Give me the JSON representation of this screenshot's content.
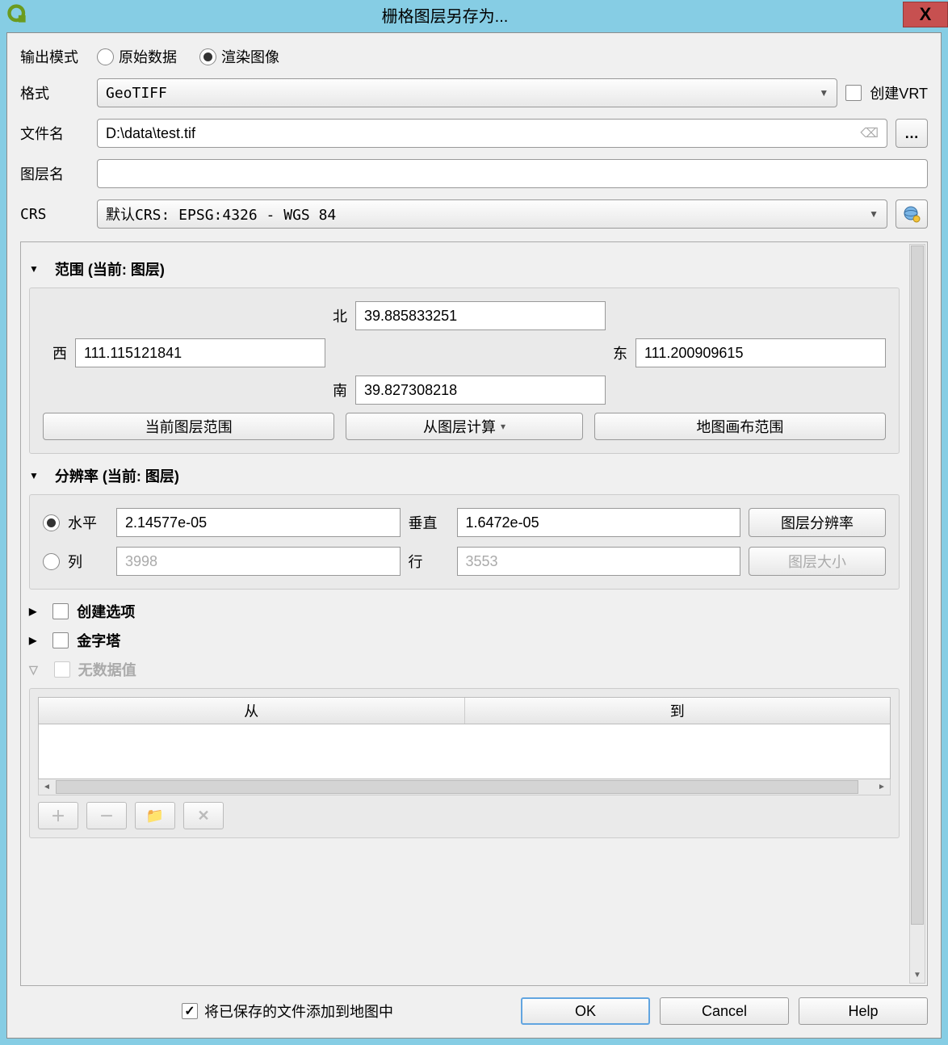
{
  "title": "栅格图层另存为...",
  "output_mode": {
    "label": "输出模式",
    "raw": "原始数据",
    "rendered": "渲染图像",
    "selected": "rendered"
  },
  "format": {
    "label": "格式",
    "value": "GeoTIFF"
  },
  "create_vrt": {
    "label": "创建VRT",
    "checked": false
  },
  "filename": {
    "label": "文件名",
    "value": "D:\\data\\test.tif"
  },
  "layername": {
    "label": "图层名",
    "value": ""
  },
  "crs": {
    "label": "CRS",
    "value": "默认CRS: EPSG:4326 - WGS 84"
  },
  "extent": {
    "title": "范围 (当前: 图层)",
    "north_label": "北",
    "north": "39.885833251",
    "south_label": "南",
    "south": "39.827308218",
    "west_label": "西",
    "west": "111.115121841",
    "east_label": "东",
    "east": "111.200909615",
    "btn_layer": "当前图层范围",
    "btn_calc": "从图层计算",
    "btn_canvas": "地图画布范围"
  },
  "resolution": {
    "title": "分辨率 (当前: 图层)",
    "h_label": "水平",
    "h_value": "2.14577e-05",
    "v_label": "垂直",
    "v_value": "1.6472e-05",
    "c_label": "列",
    "c_value": "3998",
    "r_label": "行",
    "r_value": "3553",
    "btn_res": "图层分辨率",
    "btn_size": "图层大小"
  },
  "create_options": {
    "label": "创建选项"
  },
  "pyramids": {
    "label": "金字塔"
  },
  "nodata": {
    "label": "无数据值",
    "col_from": "从",
    "col_to": "到"
  },
  "footer": {
    "add_to_map": "将已保存的文件添加到地图中",
    "ok": "OK",
    "cancel": "Cancel",
    "help": "Help"
  }
}
